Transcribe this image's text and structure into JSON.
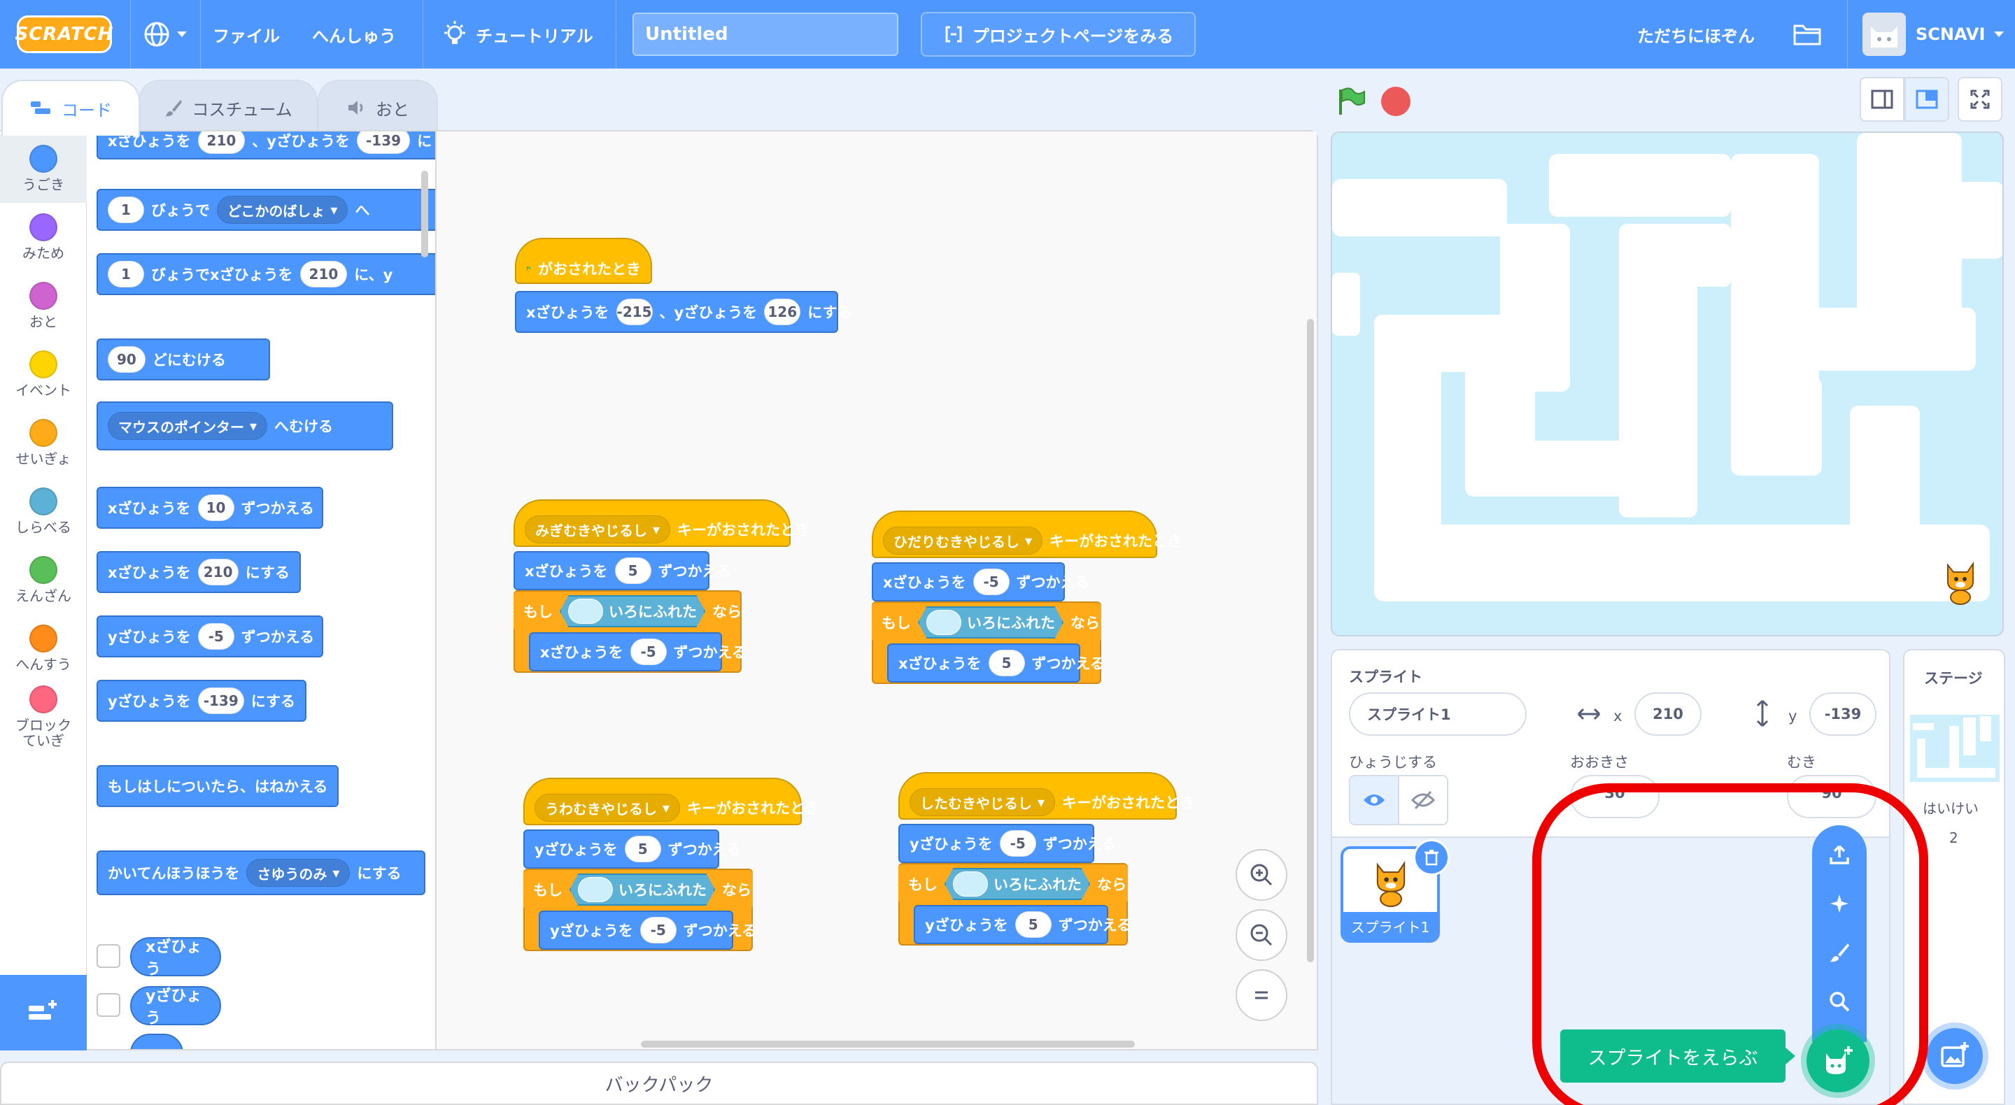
{
  "menu": {
    "logo": "SCRATCH",
    "file": "ファイル",
    "edit": "へんしゅう",
    "tutorial": "チュートリアル",
    "project_title": "Untitled",
    "project_page": "プロジェクトページをみる",
    "share_now": "ただちにほぞん",
    "username": "SCNAVI"
  },
  "tabs": {
    "code": "コード",
    "costume": "コスチューム",
    "sound": "おと"
  },
  "categories": [
    "うごき",
    "みため",
    "おと",
    "イベント",
    "せいぎょ",
    "しらべる",
    "えんざん",
    "へんすう",
    "ブロックていぎ"
  ],
  "category_colors": [
    "#4c97ff",
    "#9966ff",
    "#cf63cf",
    "#ffd500",
    "#ffab19",
    "#5cb1d6",
    "#59c059",
    "#ff8c1a",
    "#ff6680"
  ],
  "palette": {
    "goto_xy": {
      "a": "xざひょうを",
      "x": "210",
      "b": "、yざひょうを",
      "y": "-139",
      "c": "に"
    },
    "glide_to": {
      "secs": "1",
      "a": "びょうで",
      "target": "どこかのばしょ",
      "b": "へ"
    },
    "glide_xy": {
      "secs": "1",
      "a": "びょうでxざひょうを",
      "x": "210",
      "b": "に、y"
    },
    "point_dir": {
      "deg": "90",
      "a": "どにむける"
    },
    "point_towards": {
      "target": "マウスのポインター",
      "a": "へむける"
    },
    "change_x": {
      "a": "xざひょうを",
      "v": "10",
      "b": "ずつかえる"
    },
    "set_x": {
      "a": "xざひょうを",
      "v": "210",
      "b": "にする"
    },
    "change_y": {
      "a": "yざひょうを",
      "v": "-5",
      "b": "ずつかえる"
    },
    "set_y": {
      "a": "yざひょうを",
      "v": "-139",
      "b": "にする"
    },
    "bounce": "もしはしについたら、はねかえる",
    "rotation_style": {
      "a": "かいてんほうほうを",
      "v": "さゆうのみ",
      "b": "にする"
    },
    "rep_x": "xざひょう",
    "rep_y": "yざひょう"
  },
  "scripts": {
    "flag": {
      "hat": "がおされたとき",
      "set_a": "xざひょうを",
      "x": "-215",
      "set_b": "、yざひょうを",
      "y": "126",
      "set_c": "にする"
    },
    "right": {
      "key": "みぎむきやじるし",
      "hat": "キーがおされたとき",
      "c1a": "xざひょうを",
      "c1v": "5",
      "c1b": "ずつかえる",
      "if": "もし",
      "touch": "いろにふれた",
      "then": "なら",
      "c2a": "xざひょうを",
      "c2v": "-5",
      "c2b": "ずつかえる"
    },
    "left": {
      "key": "ひだりむきやじるし",
      "hat": "キーがおされたとき",
      "c1a": "xざひょうを",
      "c1v": "-5",
      "c1b": "ずつかえる",
      "if": "もし",
      "touch": "いろにふれた",
      "then": "なら",
      "c2a": "xざひょうを",
      "c2v": "5",
      "c2b": "ずつかえる"
    },
    "up": {
      "key": "うわむきやじるし",
      "hat": "キーがおされたとき",
      "c1a": "yざひょうを",
      "c1v": "5",
      "c1b": "ずつかえる",
      "if": "もし",
      "touch": "いろにふれた",
      "then": "なら",
      "c2a": "yざひょうを",
      "c2v": "-5",
      "c2b": "ずつかえる"
    },
    "down": {
      "key": "したむきやじるし",
      "hat": "キーがおされたとき",
      "c1a": "yざひょうを",
      "c1v": "-5",
      "c1b": "ずつかえる",
      "if": "もし",
      "touch": "いろにふれた",
      "then": "なら",
      "c2a": "yざひょうを",
      "c2v": "5",
      "c2b": "ずつかえる"
    }
  },
  "backpack": "バックパック",
  "sprite_info": {
    "sprite_label": "スプライト",
    "sprite_name": "スプライト1",
    "x_label": "x",
    "x": "210",
    "y_label": "y",
    "y": "-139",
    "show_label": "ひょうじする",
    "size_label": "おおきさ",
    "size": "30",
    "direction_label": "むき",
    "direction": "90"
  },
  "sprite_tile_name": "スプライト1",
  "stage_pane": {
    "title": "ステージ",
    "backdrops_label": "はいけい",
    "backdrops_count": "2"
  },
  "add_sprite_tooltip": "スプライトをえらぶ",
  "colors": {
    "menu": "#4d97ff",
    "motion": "#4c97ff",
    "events": "#ffbf00",
    "control": "#ffab19",
    "sensing": "#5cb1d6",
    "add": "#0fbd8c",
    "highlight": "#ee0000"
  }
}
